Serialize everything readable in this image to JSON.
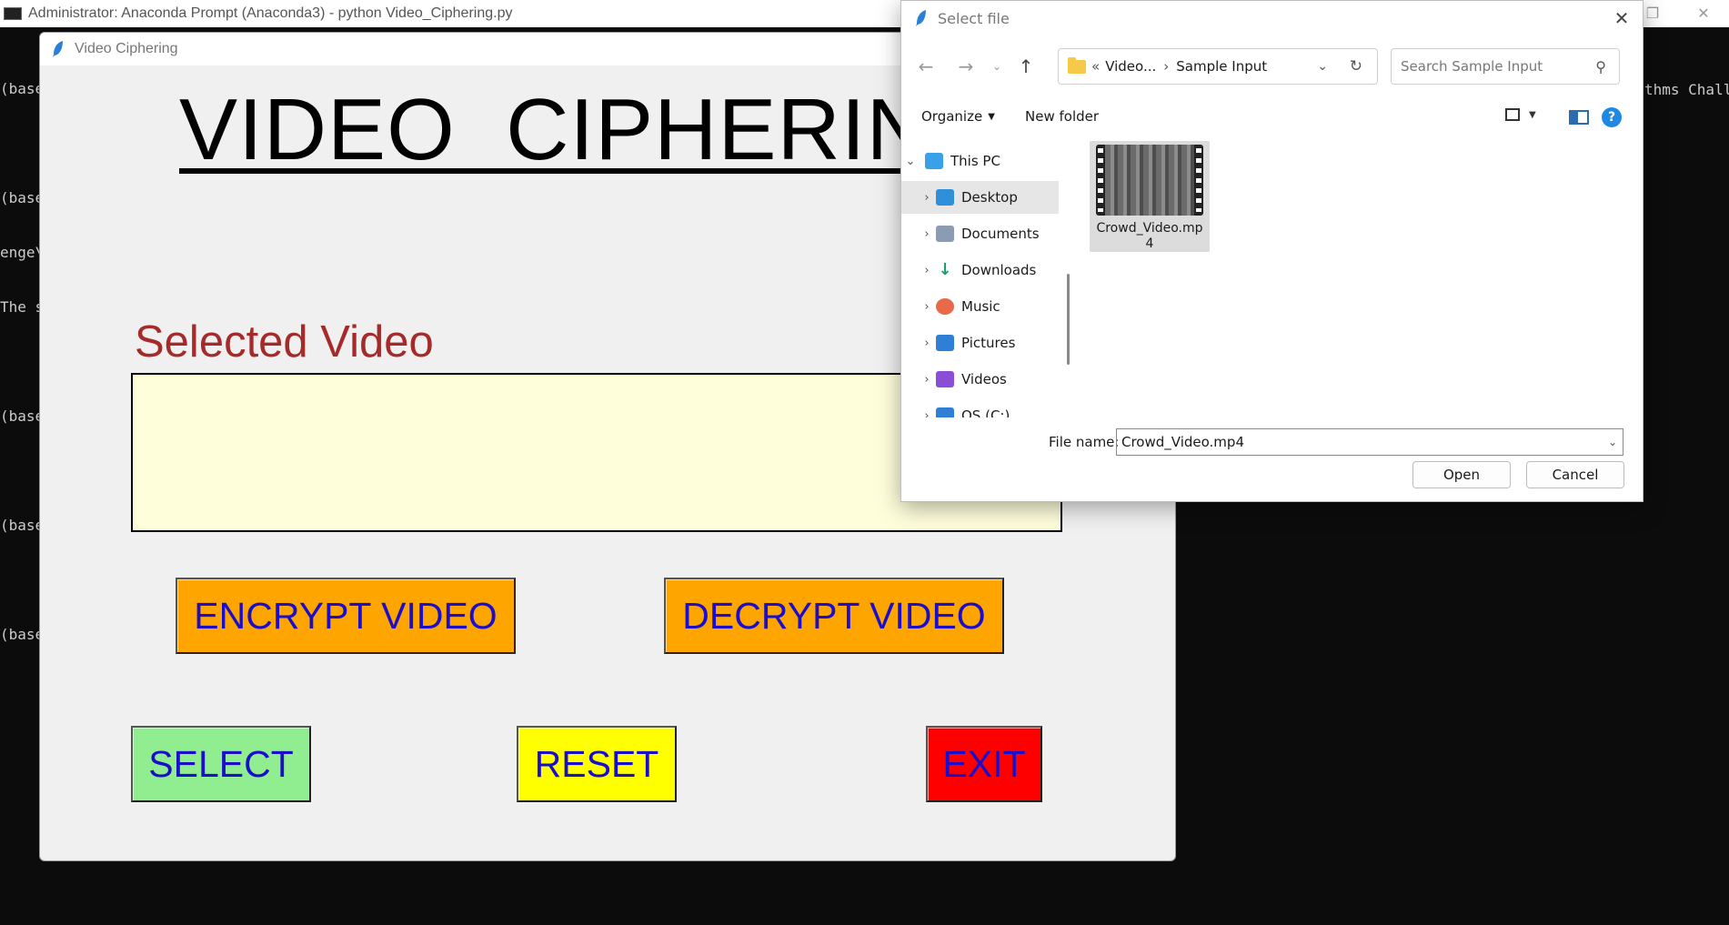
{
  "console": {
    "title": "Administrator: Anaconda Prompt (Anaconda3) - python  Video_Ciphering.py",
    "lines": [
      "(base",
      "",
      "(base",
      "enge\\",
      "The s",
      "",
      "(base",
      "",
      "(base",
      "",
      "(base"
    ],
    "right_text": "thms Chall"
  },
  "app": {
    "title": "Video Ciphering",
    "heading": "VIDEO  CIPHERING",
    "selected_label": "Selected Video",
    "buttons": {
      "encrypt": "ENCRYPT VIDEO",
      "decrypt": "DECRYPT VIDEO",
      "select": "SELECT",
      "reset": "RESET",
      "exit": "EXIT"
    }
  },
  "dialog": {
    "title": "Select file",
    "address": {
      "parent": "Video...",
      "current": "Sample Input"
    },
    "search_placeholder": "Search Sample Input",
    "commands": {
      "organize": "Organize",
      "new_folder": "New folder"
    },
    "tree": [
      {
        "label": "This PC",
        "icon": "pc-icon"
      },
      {
        "label": "Desktop",
        "icon": "desktop-icon"
      },
      {
        "label": "Documents",
        "icon": "documents-icon"
      },
      {
        "label": "Downloads",
        "icon": "downloads-icon"
      },
      {
        "label": "Music",
        "icon": "music-icon"
      },
      {
        "label": "Pictures",
        "icon": "pictures-icon"
      },
      {
        "label": "Videos",
        "icon": "videos-icon"
      },
      {
        "label": "OS (C:)",
        "icon": "drive-icon"
      }
    ],
    "files": [
      {
        "name": "Crowd_Video.mp4"
      }
    ],
    "file_name_label": "File name:",
    "file_name_value": "Crowd_Video.mp4",
    "open_label": "Open",
    "cancel_label": "Cancel"
  }
}
